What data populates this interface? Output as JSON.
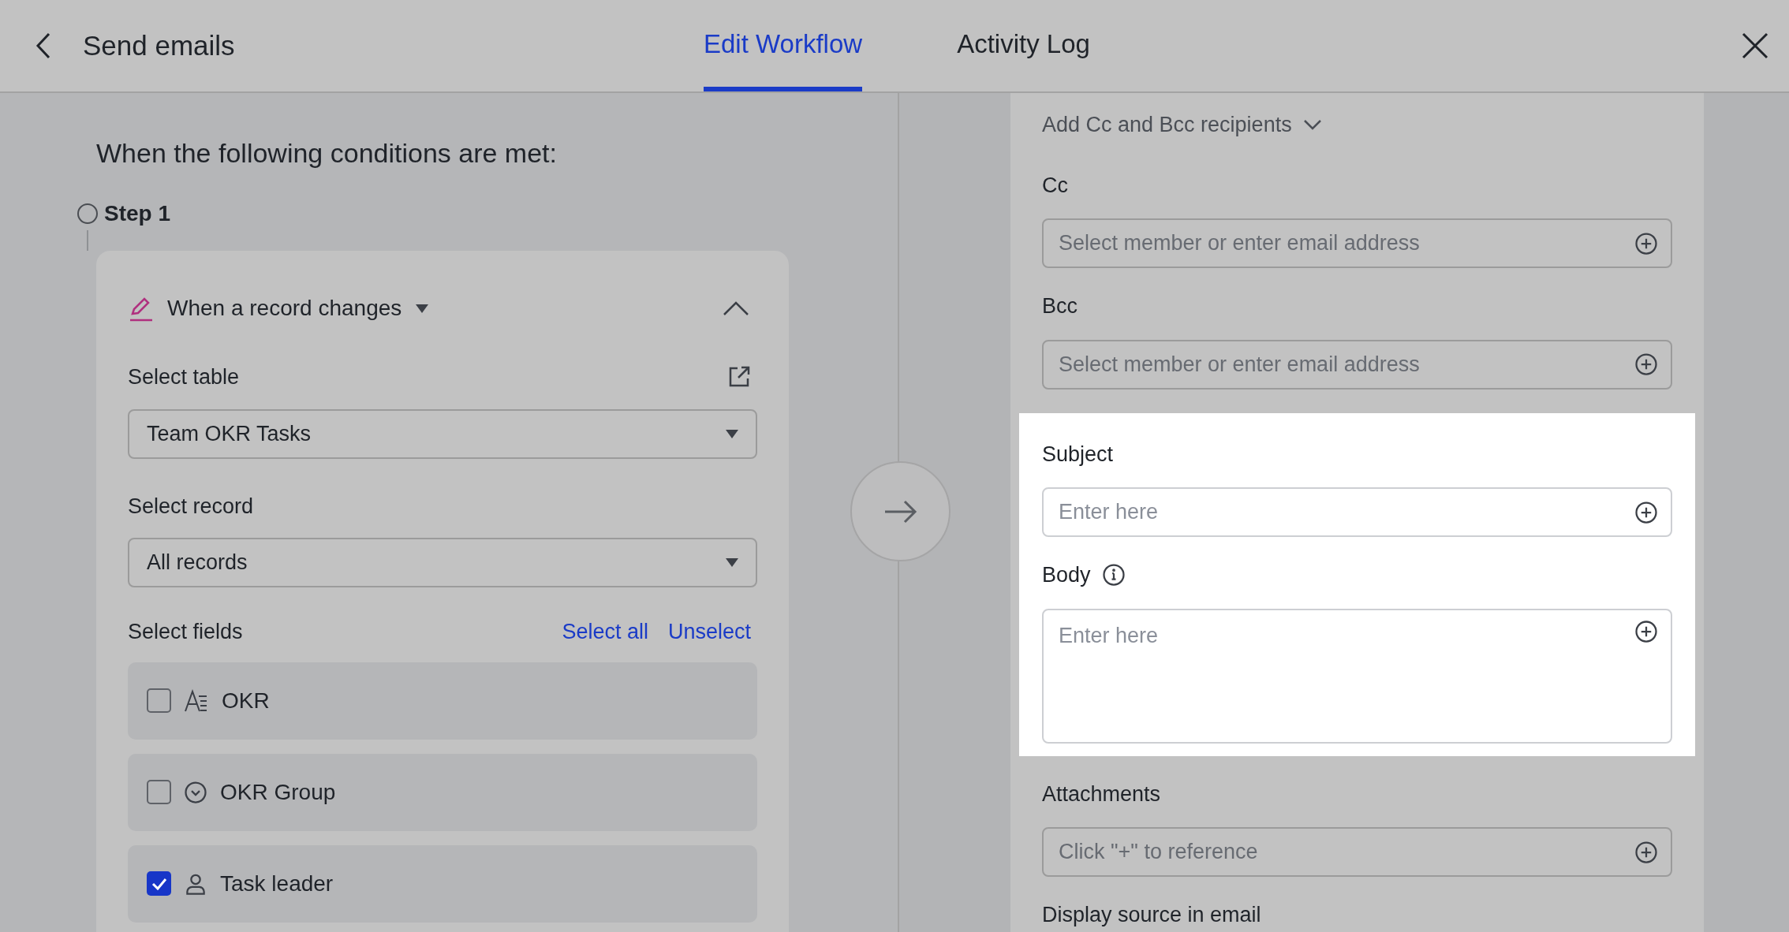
{
  "header": {
    "title": "Send emails",
    "tabs": [
      {
        "label": "Edit Workflow",
        "selected": true
      },
      {
        "label": "Activity Log",
        "selected": false
      }
    ]
  },
  "trigger": {
    "heading": "When the following conditions are met:",
    "step_label": "Step 1",
    "card": {
      "title": "When a record changes",
      "expanded": true,
      "dropdowns": [
        {
          "label": "Select table",
          "value": "Team OKR Tasks",
          "external_link": true
        },
        {
          "label": "Select record",
          "value": "All records",
          "external_link": false
        }
      ],
      "fields_label": "Select fields",
      "links": [
        "Select all",
        "Unselect"
      ],
      "fields": [
        {
          "name": "OKR",
          "kind": "text",
          "checked": false
        },
        {
          "name": "OKR Group",
          "kind": "option",
          "checked": false
        },
        {
          "name": "Task leader",
          "kind": "person",
          "checked": true
        }
      ]
    }
  },
  "email": {
    "cc_toggle": "Add Cc and Bcc recipients",
    "sections": [
      {
        "highlighted": false,
        "fields": [
          {
            "label": "Cc",
            "kind": "input",
            "placeholder": "Select member or enter email address"
          },
          {
            "label": "Bcc",
            "kind": "input",
            "placeholder": "Select member or enter email address"
          }
        ]
      },
      {
        "highlighted": true,
        "fields": [
          {
            "label": "Subject",
            "kind": "input",
            "placeholder": "Enter here"
          },
          {
            "label": "Body",
            "kind": "textarea",
            "placeholder": "Enter here",
            "info": true
          }
        ]
      },
      {
        "highlighted": false,
        "fields": [
          {
            "label": "Attachments",
            "kind": "input",
            "placeholder": "Click \"+\" to reference"
          },
          {
            "label": "Display source in email",
            "kind": "label"
          }
        ]
      }
    ]
  }
}
